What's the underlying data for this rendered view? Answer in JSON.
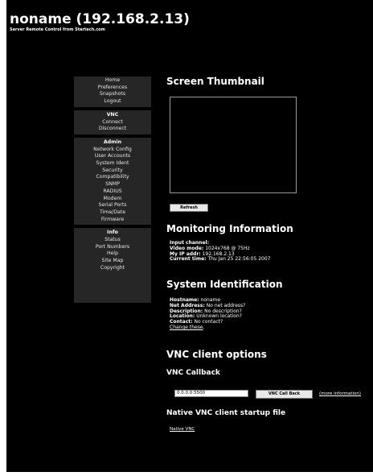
{
  "header": {
    "title": "noname (192.168.2.13)",
    "subtitle": "Server Remote Control from Startech.com"
  },
  "sidebar": {
    "group1": [
      "Home",
      "Preferences",
      "Snapshots",
      "Logout"
    ],
    "vnc_heading": "VNC",
    "vnc_items": [
      "Connect",
      "Disconnect"
    ],
    "admin_heading": "Admin",
    "admin_items": [
      "Network Config",
      "User Accounts",
      "System Ident",
      "Security",
      "Compatibility",
      "SNMP",
      "RADIUS",
      "Modem",
      "Serial Ports",
      "Time/Date",
      "Firmware"
    ],
    "info_heading": "Info",
    "info_items": [
      "Status",
      "Port Numbers",
      "Help",
      "Site Map",
      "Copyright"
    ]
  },
  "thumbnail": {
    "heading": "Screen Thumbnail",
    "refresh_label": "Refresh"
  },
  "monitoring": {
    "heading": "Monitoring Information",
    "input_channel_label": "Input channel:",
    "input_channel_value": "",
    "video_mode_label": "Video mode:",
    "video_mode_value": "1024x768 @ 75Hz",
    "ip_label": "My IP addr:",
    "ip_value": "192.168.2.13",
    "time_label": "Current time:",
    "time_value": "Thu Jan 25 22:56:05 2007"
  },
  "identification": {
    "heading": "System Identification",
    "hostname_label": "Hostname:",
    "hostname_value": "noname",
    "net_label": "Net Address:",
    "net_value": "No net address?",
    "desc_label": "Description:",
    "desc_value": "No description?",
    "loc_label": "Location:",
    "loc_value": "Unknown location?",
    "contact_label": "Contact:",
    "contact_value": "No contact?",
    "change_link": "Change these",
    "change_suffix": "."
  },
  "vnc_options": {
    "heading": "VNC client options",
    "callback_heading": "VNC Callback",
    "callback_value": "0.0.0.0:5500",
    "callback_button": "VNC Call Back",
    "more_info_link": "(more information)",
    "startup_heading": "Native VNC client startup file",
    "native_link": "Native VNC"
  }
}
